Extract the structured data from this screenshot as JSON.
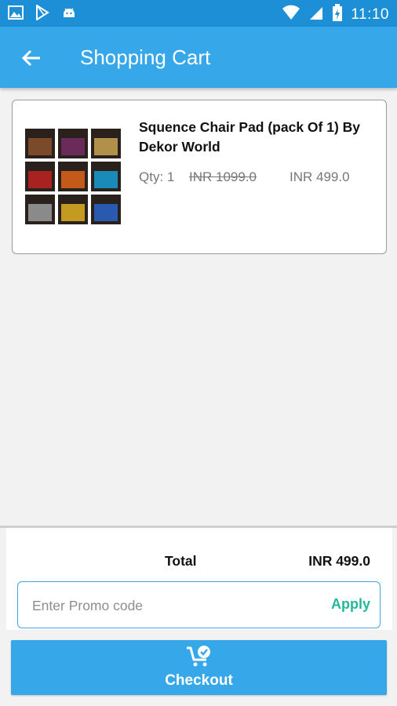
{
  "status_bar": {
    "time": "11:10",
    "icons": [
      "gallery-icon",
      "play-store-icon",
      "android-icon",
      "wifi-icon",
      "signal-icon",
      "battery-icon"
    ]
  },
  "app_bar": {
    "title": "Shopping Cart",
    "back_icon": "back-arrow-icon"
  },
  "cart": {
    "items": [
      {
        "name": "Squence Chair Pad (pack Of 1) By Dekor World",
        "qty_label": "Qty: 1",
        "mrp": "INR 1099.0",
        "price": "INR 499.0"
      }
    ]
  },
  "summary": {
    "total_label": "Total",
    "total_value": "INR 499.0"
  },
  "promo": {
    "placeholder": "Enter Promo code",
    "value": "",
    "apply_label": "Apply"
  },
  "checkout": {
    "label": "Checkout",
    "icon": "cart-check-icon"
  },
  "colors": {
    "status_bar": "#1c8fd6",
    "app_bar": "#36a8ea",
    "apply": "#25b79a"
  }
}
